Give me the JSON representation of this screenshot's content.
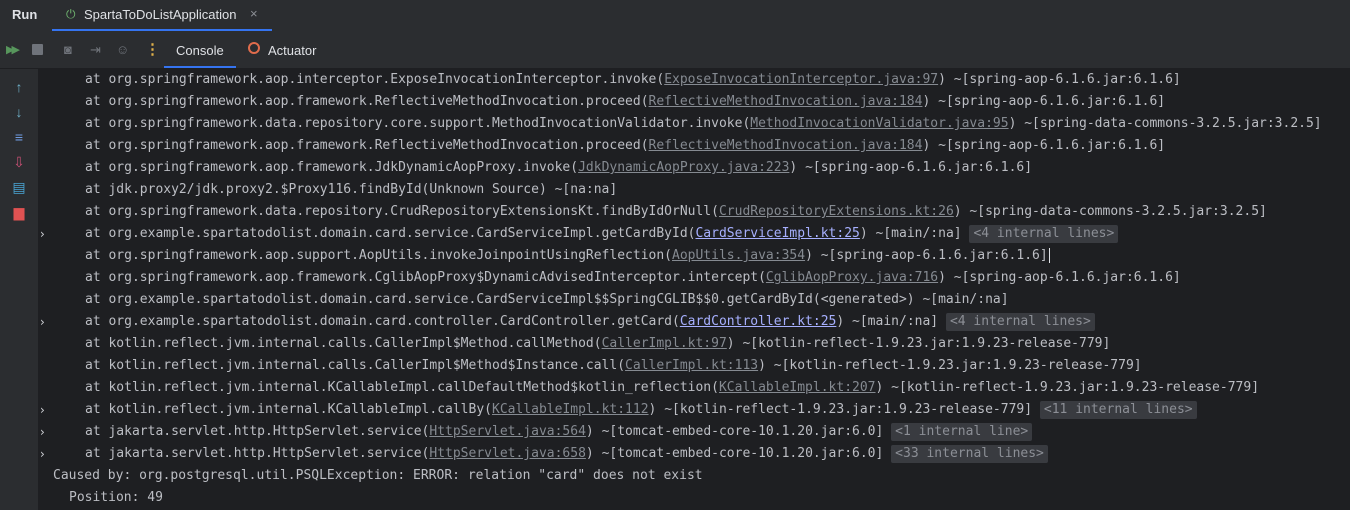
{
  "window": {
    "run_label": "Run",
    "run_tab_label": "SpartaToDoListApplication",
    "close_glyph": "×"
  },
  "toolbar": {
    "console_label": "Console",
    "actuator_label": "Actuator"
  },
  "icons": {
    "rerun": "rerun-icon",
    "stop": "stop-icon",
    "screenshot": "camera-icon",
    "exit": "exit-icon",
    "more": "more-vertical-icon",
    "up": "arrow-up-icon",
    "down": "arrow-down-icon",
    "wrap": "soft-wrap-icon",
    "scroll_end": "scroll-to-end-icon",
    "print": "print-icon",
    "clear": "trash-icon"
  },
  "console": {
    "lines": [
      {
        "pre": "at org.springframework.aop.interceptor.ExposeInvocationInterceptor.invoke(",
        "link": "ExposeInvocationInterceptor.java:97",
        "post": ") ~[spring-aop-6.1.6.jar:6.1.6]",
        "fold": "",
        "chevron": ""
      },
      {
        "pre": "at org.springframework.aop.framework.ReflectiveMethodInvocation.proceed(",
        "link": "ReflectiveMethodInvocation.java:184",
        "post": ") ~[spring-aop-6.1.6.jar:6.1.6]",
        "fold": "",
        "chevron": ""
      },
      {
        "pre": "at org.springframework.data.repository.core.support.MethodInvocationValidator.invoke(",
        "link": "MethodInvocationValidator.java:95",
        "post": ") ~[spring-data-commons-3.2.5.jar:3.2.5]",
        "fold": "",
        "chevron": ""
      },
      {
        "pre": "at org.springframework.aop.framework.ReflectiveMethodInvocation.proceed(",
        "link": "ReflectiveMethodInvocation.java:184",
        "post": ") ~[spring-aop-6.1.6.jar:6.1.6]",
        "fold": "",
        "chevron": ""
      },
      {
        "pre": "at org.springframework.aop.framework.JdkDynamicAopProxy.invoke(",
        "link": "JdkDynamicAopProxy.java:223",
        "post": ") ~[spring-aop-6.1.6.jar:6.1.6]",
        "fold": "",
        "chevron": ""
      },
      {
        "pre": "at jdk.proxy2/jdk.proxy2.$Proxy116.findById(Unknown Source) ~[na:na]",
        "link": "",
        "post": "",
        "fold": "",
        "chevron": ""
      },
      {
        "pre": "at org.springframework.data.repository.CrudRepositoryExtensionsKt.findByIdOrNull(",
        "link": "CrudRepositoryExtensions.kt:26",
        "post": ") ~[spring-data-commons-3.2.5.jar:3.2.5]",
        "fold": "",
        "chevron": ""
      },
      {
        "pre": "at org.example.spartatodolist.domain.card.service.CardServiceImpl.getCardById(",
        "link": "CardServiceImpl.kt:25",
        "post": ") ~[main/:na] ",
        "fold": "<4 internal lines>",
        "chevron": "›",
        "project": true
      },
      {
        "pre": "at org.springframework.aop.support.AopUtils.invokeJoinpointUsingReflection(",
        "link": "AopUtils.java:354",
        "post": ") ~[spring-aop-6.1.6.jar:6.1.6]",
        "fold": "",
        "chevron": "",
        "caret": true
      },
      {
        "pre": "at org.springframework.aop.framework.CglibAopProxy$DynamicAdvisedInterceptor.intercept(",
        "link": "CglibAopProxy.java:716",
        "post": ") ~[spring-aop-6.1.6.jar:6.1.6]",
        "fold": "",
        "chevron": ""
      },
      {
        "pre": "at org.example.spartatodolist.domain.card.service.CardServiceImpl$$SpringCGLIB$$0.getCardById(<generated>) ~[main/:na]",
        "link": "",
        "post": "",
        "fold": "",
        "chevron": ""
      },
      {
        "pre": "at org.example.spartatodolist.domain.card.controller.CardController.getCard(",
        "link": "CardController.kt:25",
        "post": ") ~[main/:na] ",
        "fold": "<4 internal lines>",
        "chevron": "›",
        "project": true
      },
      {
        "pre": "at kotlin.reflect.jvm.internal.calls.CallerImpl$Method.callMethod(",
        "link": "CallerImpl.kt:97",
        "post": ") ~[kotlin-reflect-1.9.23.jar:1.9.23-release-779]",
        "fold": "",
        "chevron": ""
      },
      {
        "pre": "at kotlin.reflect.jvm.internal.calls.CallerImpl$Method$Instance.call(",
        "link": "CallerImpl.kt:113",
        "post": ") ~[kotlin-reflect-1.9.23.jar:1.9.23-release-779]",
        "fold": "",
        "chevron": ""
      },
      {
        "pre": "at kotlin.reflect.jvm.internal.KCallableImpl.callDefaultMethod$kotlin_reflection(",
        "link": "KCallableImpl.kt:207",
        "post": ") ~[kotlin-reflect-1.9.23.jar:1.9.23-release-779]",
        "fold": "",
        "chevron": ""
      },
      {
        "pre": "at kotlin.reflect.jvm.internal.KCallableImpl.callBy(",
        "link": "KCallableImpl.kt:112",
        "post": ") ~[kotlin-reflect-1.9.23.jar:1.9.23-release-779] ",
        "fold": "<11 internal lines>",
        "chevron": "›"
      },
      {
        "pre": "at jakarta.servlet.http.HttpServlet.service(",
        "link": "HttpServlet.java:564",
        "post": ") ~[tomcat-embed-core-10.1.20.jar:6.0] ",
        "fold": "<1 internal line>",
        "chevron": "›"
      },
      {
        "pre": "at jakarta.servlet.http.HttpServlet.service(",
        "link": "HttpServlet.java:658",
        "post": ") ~[tomcat-embed-core-10.1.20.jar:6.0] ",
        "fold": "<33 internal lines>",
        "chevron": "›"
      }
    ],
    "caused_by": "Caused by: org.postgresql.util.PSQLException: ERROR: relation \"card\" does not exist",
    "position": "Position: 49"
  }
}
